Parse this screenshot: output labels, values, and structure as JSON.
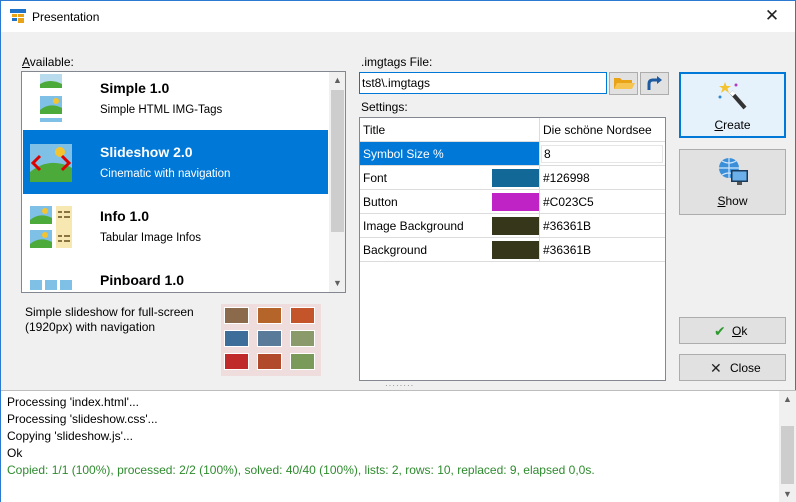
{
  "window": {
    "title": "Presentation"
  },
  "available": {
    "label_accel": "A",
    "label_rest": "vailable:",
    "items": [
      {
        "name": "Simple 1.0",
        "desc": "Simple HTML IMG-Tags",
        "icon": "landscape-icon"
      },
      {
        "name": "Slideshow 2.0",
        "desc": "Cinematic with navigation",
        "icon": "slideshow-icon",
        "selected": true
      },
      {
        "name": "Info 1.0",
        "desc": "Tabular Image Infos",
        "icon": "info-table-icon"
      },
      {
        "name": "Pinboard 1.0",
        "desc": "",
        "icon": "pinboard-icon"
      }
    ],
    "selected_description": "Simple slideshow for full-screen (1920px) with navigation"
  },
  "file": {
    "label": ".imgtags File:",
    "value": "tst8\\.imgtags"
  },
  "settings": {
    "label": "Settings:",
    "rows": [
      {
        "key": "Title",
        "value": "Die schöne Nordsee"
      },
      {
        "key": "Symbol Size %",
        "value": "8",
        "selected": true
      },
      {
        "key": "Font",
        "value": "#126998",
        "color": "#126998"
      },
      {
        "key": "Button",
        "value": "#C023C5",
        "color": "#C023C5"
      },
      {
        "key": "Image Background",
        "value": "#36361B",
        "color": "#36361B"
      },
      {
        "key": "Background",
        "value": "#36361B",
        "color": "#36361B"
      }
    ]
  },
  "buttons": {
    "create_accel": "C",
    "create_rest": "reate",
    "show_accel": "S",
    "show_rest": "how",
    "ok_accel": "O",
    "ok_rest": "k",
    "close": "Close"
  },
  "log": {
    "lines": [
      "Processing 'index.html'...",
      "Processing 'slideshow.css'...",
      "Copying 'slideshow.js'...",
      "Ok"
    ],
    "summary": "Copied: 1/1 (100%), processed: 2/2 (100%), solved: 40/40 (100%), lists: 2, rows: 10, replaced: 9, elapsed 0,0s."
  },
  "colors": {
    "accent": "#0078d7",
    "log_ok": "#2e8b2e"
  }
}
